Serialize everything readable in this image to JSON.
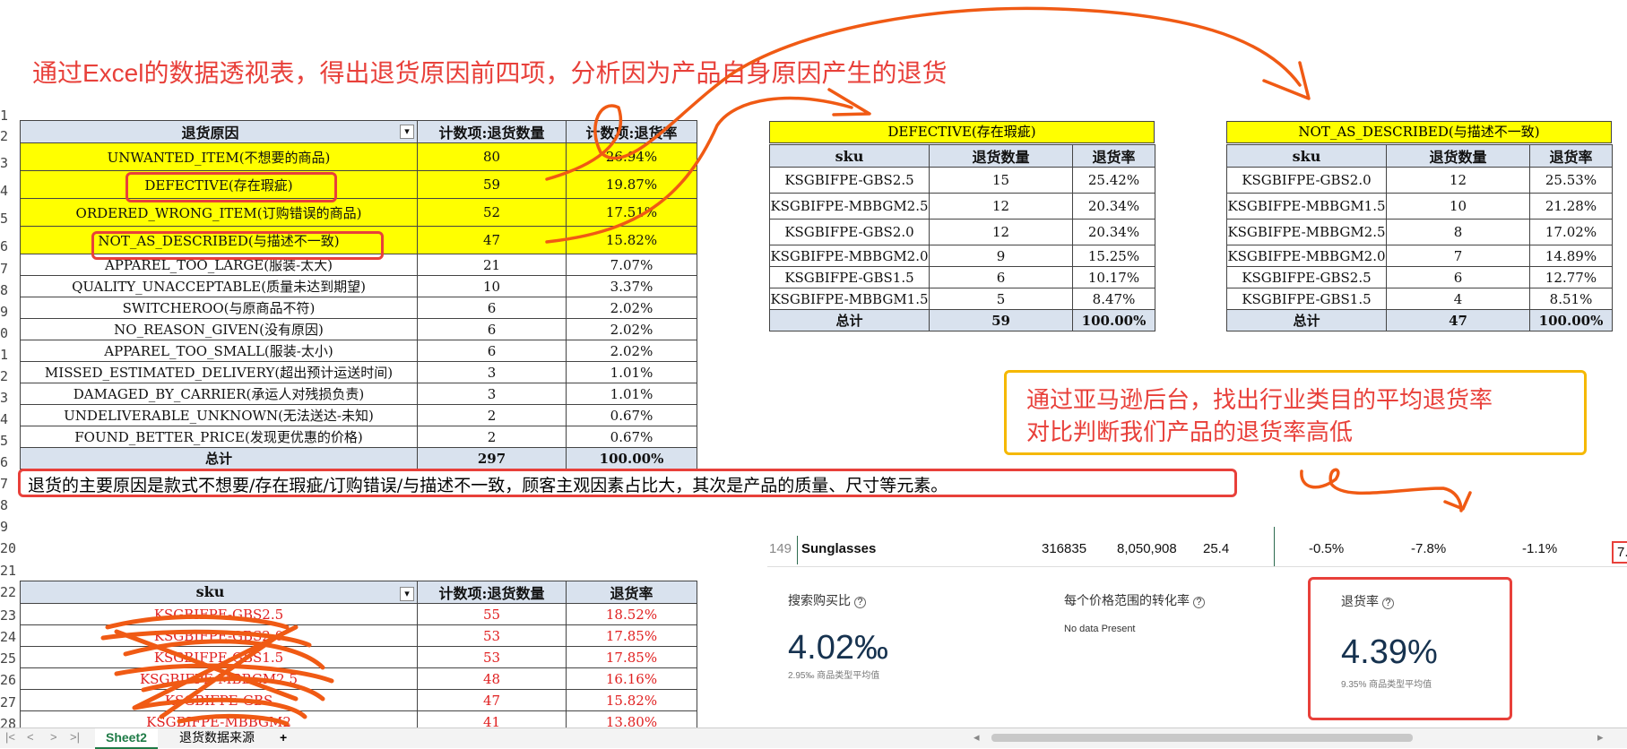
{
  "annotation_title": "通过Excel的数据透视表，得出退货原因前四项，分析因为产品自身原因产生的退货",
  "row_numbers": [
    "1",
    "2",
    "3",
    "4",
    "5",
    "6",
    "7",
    "8",
    "9",
    "0",
    "1",
    "2",
    "3",
    "4",
    "5",
    "6",
    "7",
    "8",
    "9",
    "20",
    "21",
    "22",
    "23",
    "24",
    "25",
    "26",
    "27",
    "28"
  ],
  "reason_table": {
    "headers": [
      "退货原因",
      "计数项:退货数量",
      "计数项:退货率"
    ],
    "rows": [
      [
        "UNWANTED_ITEM(不想要的商品)",
        "80",
        "26.94%"
      ],
      [
        "DEFECTIVE(存在瑕疵)",
        "59",
        "19.87%"
      ],
      [
        "ORDERED_WRONG_ITEM(订购错误的商品)",
        "52",
        "17.51%"
      ],
      [
        "NOT_AS_DESCRIBED(与描述不一致)",
        "47",
        "15.82%"
      ],
      [
        "APPAREL_TOO_LARGE(服装-太大)",
        "21",
        "7.07%"
      ],
      [
        "QUALITY_UNACCEPTABLE(质量未达到期望)",
        "10",
        "3.37%"
      ],
      [
        "SWITCHEROO(与原商品不符)",
        "6",
        "2.02%"
      ],
      [
        "NO_REASON_GIVEN(没有原因)",
        "6",
        "2.02%"
      ],
      [
        "APPAREL_TOO_SMALL(服装-太小)",
        "6",
        "2.02%"
      ],
      [
        "MISSED_ESTIMATED_DELIVERY(超出预计运送时间)",
        "3",
        "1.01%"
      ],
      [
        "DAMAGED_BY_CARRIER(承运人对残损负责)",
        "3",
        "1.01%"
      ],
      [
        "UNDELIVERABLE_UNKNOWN(无法送达-未知)",
        "2",
        "0.67%"
      ],
      [
        "FOUND_BETTER_PRICE(发现更优惠的价格)",
        "2",
        "0.67%"
      ]
    ],
    "total": [
      "总计",
      "297",
      "100.00%"
    ]
  },
  "defective_table": {
    "title": "DEFECTIVE(存在瑕疵)",
    "headers": [
      "sku",
      "退货数量",
      "退货率"
    ],
    "rows": [
      [
        "KSGBIFPE-GBS2.5",
        "15",
        "25.42%"
      ],
      [
        "KSGBIFPE-MBBGM2.5",
        "12",
        "20.34%"
      ],
      [
        "KSGBIFPE-GBS2.0",
        "12",
        "20.34%"
      ],
      [
        "KSGBIFPE-MBBGM2.0",
        "9",
        "15.25%"
      ],
      [
        "KSGBIFPE-GBS1.5",
        "6",
        "10.17%"
      ],
      [
        "KSGBIFPE-MBBGM1.5",
        "5",
        "8.47%"
      ]
    ],
    "total": [
      "总计",
      "59",
      "100.00%"
    ]
  },
  "not_described_table": {
    "title": "NOT_AS_DESCRIBED(与描述不一致)",
    "headers": [
      "sku",
      "退货数量",
      "退货率"
    ],
    "rows": [
      [
        "KSGBIFPE-GBS2.0",
        "12",
        "25.53%"
      ],
      [
        "KSGBIFPE-MBBGM1.5",
        "10",
        "21.28%"
      ],
      [
        "KSGBIFPE-MBBGM2.5",
        "8",
        "17.02%"
      ],
      [
        "KSGBIFPE-MBBGM2.0",
        "7",
        "14.89%"
      ],
      [
        "KSGBIFPE-GBS2.5",
        "6",
        "12.77%"
      ],
      [
        "KSGBIFPE-GBS1.5",
        "4",
        "8.51%"
      ]
    ],
    "total": [
      "总计",
      "47",
      "100.00%"
    ]
  },
  "summary_text": "退货的主要原因是款式不想要/存在瑕疵/订购错误/与描述不一致，顾客主观因素占比大，其次是产品的质量、尺寸等元素。",
  "callout": {
    "line1": "通过亚马逊后台，找出行业类目的平均退货率",
    "line2": "对比判断我们产品的退货率高低"
  },
  "amazon_row": {
    "rank": "149",
    "category": "Sunglasses",
    "v1": "316835",
    "v2": "8,050,908",
    "v3": "25.4",
    "p1": "-0.5%",
    "p2": "-7.8%",
    "p3": "-1.1%",
    "cut": "7."
  },
  "amazon_panels": {
    "search_label": "搜索购买比",
    "search_value": "4.02‰",
    "search_avg": "2.95‰ 商品类型平均值",
    "conv_label": "每个价格范围的转化率",
    "conv_note": "No data Present",
    "return_label": "退货率",
    "return_value": "4.39%",
    "return_avg": "9.35% 商品类型平均值",
    "info_icon": "info-circle-icon"
  },
  "sku_table": {
    "headers": [
      "sku",
      "计数项:退货数量",
      "退货率"
    ],
    "rows": [
      [
        "KSGBIFPE-GBS2.5",
        "55",
        "18.52%"
      ],
      [
        "KSGBIFPE-GBS2.0",
        "53",
        "17.85%"
      ],
      [
        "KSGBIFPE-GBS1.5",
        "53",
        "17.85%"
      ],
      [
        "KSGBIFPE-MBBGM2.5",
        "48",
        "16.16%"
      ],
      [
        "KSGBIFPE-GBS",
        "47",
        "15.82%"
      ],
      [
        "KSGBIFPE-MBBGM2",
        "41",
        "13.80%"
      ]
    ]
  },
  "sheet_tabs": {
    "active": "Sheet2",
    "other": "退货数据来源",
    "add": "+"
  },
  "colors": {
    "annotation_red": "#e8403a",
    "highlight_yellow": "#ffff00",
    "header_blue": "#d9e2ee",
    "callout_border": "#f5b800",
    "scribble_orange": "#f05a14"
  }
}
